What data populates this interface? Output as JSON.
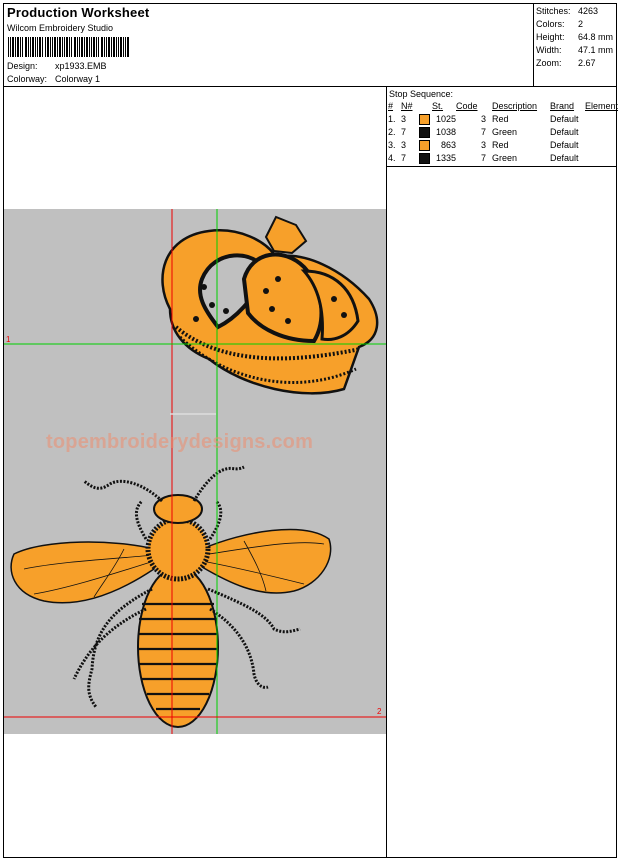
{
  "header": {
    "title": "Production Worksheet",
    "software": "Wilcom Embroidery Studio",
    "design_label": "Design:",
    "design_value": "xp1933.EMB",
    "colorway_label": "Colorway:",
    "colorway_value": "Colorway 1"
  },
  "stats": [
    {
      "label": "Stitches:",
      "value": "4263"
    },
    {
      "label": "Colors:",
      "value": "2"
    },
    {
      "label": "Height:",
      "value": "64.8 mm"
    },
    {
      "label": "Width:",
      "value": "47.1 mm"
    },
    {
      "label": "Zoom:",
      "value": "2.67"
    }
  ],
  "stop_sequence": {
    "title": "Stop Sequence:",
    "columns": {
      "num": "#",
      "n": "N#",
      "st": "St.",
      "code": "Code",
      "desc": "Description",
      "brand": "Brand",
      "element": "Element"
    },
    "rows": [
      {
        "num": "1.",
        "n": "3",
        "color": "#f7a02a",
        "st": "1025",
        "code": "3",
        "desc": "Red",
        "brand": "Default"
      },
      {
        "num": "2.",
        "n": "7",
        "color": "#111111",
        "st": "1038",
        "code": "7",
        "desc": "Green",
        "brand": "Default"
      },
      {
        "num": "3.",
        "n": "3",
        "color": "#f7a02a",
        "st": "863",
        "code": "3",
        "desc": "Red",
        "brand": "Default"
      },
      {
        "num": "4.",
        "n": "7",
        "color": "#111111",
        "st": "1335",
        "code": "7",
        "desc": "Green",
        "brand": "Default"
      }
    ]
  },
  "preview": {
    "watermark": "topembroiderydesigns.com",
    "marker_1": "1",
    "marker_2": "2",
    "background": "#c0c0c0",
    "thread_fill": "#f7a02a",
    "thread_outline": "#111111"
  }
}
